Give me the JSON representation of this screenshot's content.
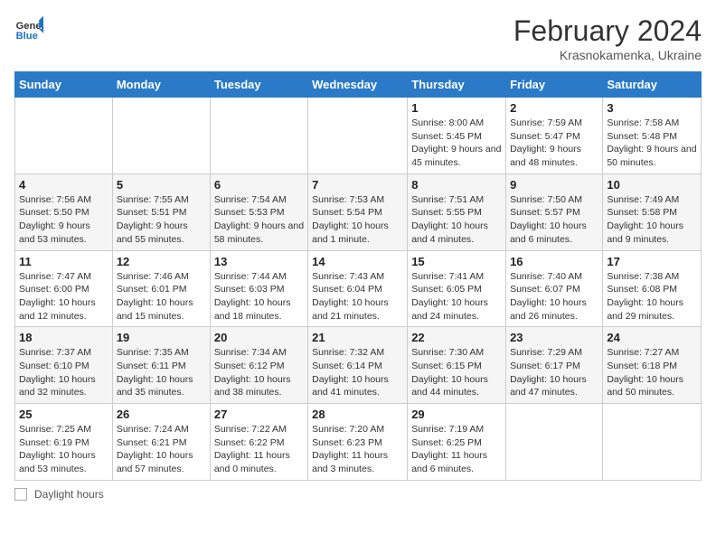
{
  "header": {
    "logo_general": "General",
    "logo_blue": "Blue",
    "month_title": "February 2024",
    "location": "Krasnokamenka, Ukraine"
  },
  "days_of_week": [
    "Sunday",
    "Monday",
    "Tuesday",
    "Wednesday",
    "Thursday",
    "Friday",
    "Saturday"
  ],
  "weeks": [
    [
      {
        "day": "",
        "info": ""
      },
      {
        "day": "",
        "info": ""
      },
      {
        "day": "",
        "info": ""
      },
      {
        "day": "",
        "info": ""
      },
      {
        "day": "1",
        "info": "Sunrise: 8:00 AM\nSunset: 5:45 PM\nDaylight: 9 hours and 45 minutes."
      },
      {
        "day": "2",
        "info": "Sunrise: 7:59 AM\nSunset: 5:47 PM\nDaylight: 9 hours and 48 minutes."
      },
      {
        "day": "3",
        "info": "Sunrise: 7:58 AM\nSunset: 5:48 PM\nDaylight: 9 hours and 50 minutes."
      }
    ],
    [
      {
        "day": "4",
        "info": "Sunrise: 7:56 AM\nSunset: 5:50 PM\nDaylight: 9 hours and 53 minutes."
      },
      {
        "day": "5",
        "info": "Sunrise: 7:55 AM\nSunset: 5:51 PM\nDaylight: 9 hours and 55 minutes."
      },
      {
        "day": "6",
        "info": "Sunrise: 7:54 AM\nSunset: 5:53 PM\nDaylight: 9 hours and 58 minutes."
      },
      {
        "day": "7",
        "info": "Sunrise: 7:53 AM\nSunset: 5:54 PM\nDaylight: 10 hours and 1 minute."
      },
      {
        "day": "8",
        "info": "Sunrise: 7:51 AM\nSunset: 5:55 PM\nDaylight: 10 hours and 4 minutes."
      },
      {
        "day": "9",
        "info": "Sunrise: 7:50 AM\nSunset: 5:57 PM\nDaylight: 10 hours and 6 minutes."
      },
      {
        "day": "10",
        "info": "Sunrise: 7:49 AM\nSunset: 5:58 PM\nDaylight: 10 hours and 9 minutes."
      }
    ],
    [
      {
        "day": "11",
        "info": "Sunrise: 7:47 AM\nSunset: 6:00 PM\nDaylight: 10 hours and 12 minutes."
      },
      {
        "day": "12",
        "info": "Sunrise: 7:46 AM\nSunset: 6:01 PM\nDaylight: 10 hours and 15 minutes."
      },
      {
        "day": "13",
        "info": "Sunrise: 7:44 AM\nSunset: 6:03 PM\nDaylight: 10 hours and 18 minutes."
      },
      {
        "day": "14",
        "info": "Sunrise: 7:43 AM\nSunset: 6:04 PM\nDaylight: 10 hours and 21 minutes."
      },
      {
        "day": "15",
        "info": "Sunrise: 7:41 AM\nSunset: 6:05 PM\nDaylight: 10 hours and 24 minutes."
      },
      {
        "day": "16",
        "info": "Sunrise: 7:40 AM\nSunset: 6:07 PM\nDaylight: 10 hours and 26 minutes."
      },
      {
        "day": "17",
        "info": "Sunrise: 7:38 AM\nSunset: 6:08 PM\nDaylight: 10 hours and 29 minutes."
      }
    ],
    [
      {
        "day": "18",
        "info": "Sunrise: 7:37 AM\nSunset: 6:10 PM\nDaylight: 10 hours and 32 minutes."
      },
      {
        "day": "19",
        "info": "Sunrise: 7:35 AM\nSunset: 6:11 PM\nDaylight: 10 hours and 35 minutes."
      },
      {
        "day": "20",
        "info": "Sunrise: 7:34 AM\nSunset: 6:12 PM\nDaylight: 10 hours and 38 minutes."
      },
      {
        "day": "21",
        "info": "Sunrise: 7:32 AM\nSunset: 6:14 PM\nDaylight: 10 hours and 41 minutes."
      },
      {
        "day": "22",
        "info": "Sunrise: 7:30 AM\nSunset: 6:15 PM\nDaylight: 10 hours and 44 minutes."
      },
      {
        "day": "23",
        "info": "Sunrise: 7:29 AM\nSunset: 6:17 PM\nDaylight: 10 hours and 47 minutes."
      },
      {
        "day": "24",
        "info": "Sunrise: 7:27 AM\nSunset: 6:18 PM\nDaylight: 10 hours and 50 minutes."
      }
    ],
    [
      {
        "day": "25",
        "info": "Sunrise: 7:25 AM\nSunset: 6:19 PM\nDaylight: 10 hours and 53 minutes."
      },
      {
        "day": "26",
        "info": "Sunrise: 7:24 AM\nSunset: 6:21 PM\nDaylight: 10 hours and 57 minutes."
      },
      {
        "day": "27",
        "info": "Sunrise: 7:22 AM\nSunset: 6:22 PM\nDaylight: 11 hours and 0 minutes."
      },
      {
        "day": "28",
        "info": "Sunrise: 7:20 AM\nSunset: 6:23 PM\nDaylight: 11 hours and 3 minutes."
      },
      {
        "day": "29",
        "info": "Sunrise: 7:19 AM\nSunset: 6:25 PM\nDaylight: 11 hours and 6 minutes."
      },
      {
        "day": "",
        "info": ""
      },
      {
        "day": "",
        "info": ""
      }
    ]
  ],
  "footer": {
    "legend_label": "Daylight hours"
  }
}
